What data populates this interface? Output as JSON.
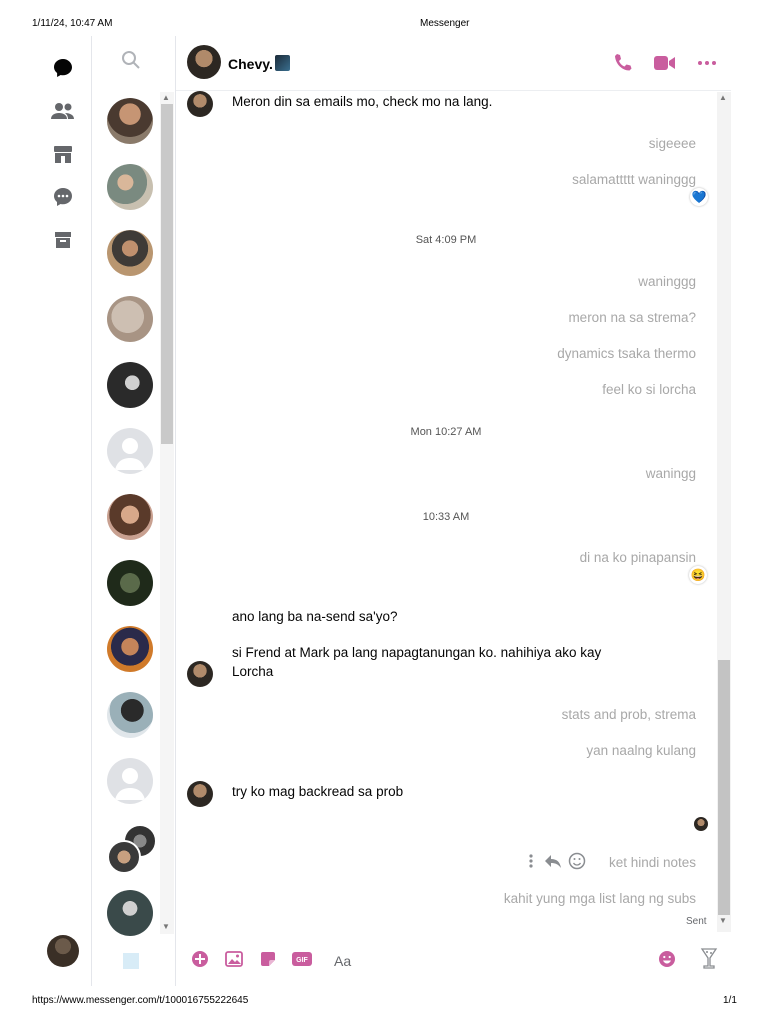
{
  "print_header": {
    "datetime": "1/11/24, 10:47 AM",
    "title": "Messenger"
  },
  "print_footer": {
    "url": "https://www.messenger.com/t/100016755222645",
    "page": "1/1"
  },
  "nav": {
    "icons": [
      "chats-icon",
      "people-icon",
      "marketplace-icon",
      "requests-icon",
      "archive-icon"
    ]
  },
  "chat_list": {
    "avatar_count": 13
  },
  "header": {
    "name": "Chevy."
  },
  "accent_color": "#c95d9e",
  "messages": [
    {
      "dir": "in",
      "text": "Meron din sa emails mo, check mo na lang."
    },
    {
      "dir": "out",
      "text": "sigeeee"
    },
    {
      "dir": "out",
      "text": "salamattttt waninggg",
      "reaction": "💙"
    },
    {
      "dir": "ts",
      "text": "Sat 4:09 PM"
    },
    {
      "dir": "out",
      "text": "waninggg"
    },
    {
      "dir": "out",
      "text": "meron na sa strema?"
    },
    {
      "dir": "out",
      "text": "dynamics tsaka thermo"
    },
    {
      "dir": "out",
      "text": "feel ko si lorcha"
    },
    {
      "dir": "ts",
      "text": "Mon 10:27 AM"
    },
    {
      "dir": "out",
      "text": "waningg"
    },
    {
      "dir": "ts",
      "text": "10:33 AM"
    },
    {
      "dir": "out",
      "text": "di na ko pinapansin",
      "reaction": "😆"
    },
    {
      "dir": "in",
      "text": "ano lang ba na-send sa'yo?"
    },
    {
      "dir": "in",
      "text": "si Frend at Mark pa lang napagtanungan ko. nahihiya ako kay"
    },
    {
      "dir": "in",
      "text": "Lorcha"
    },
    {
      "dir": "out",
      "text": "stats and prob, strema"
    },
    {
      "dir": "out",
      "text": "yan naalng kulang"
    },
    {
      "dir": "in",
      "text": "try ko mag backread sa prob"
    },
    {
      "dir": "out",
      "text": "ket hindi notes"
    },
    {
      "dir": "out",
      "text": "kahit yung mga list lang ng subs"
    }
  ],
  "status": {
    "sent": "Sent"
  },
  "composer": {
    "placeholder": "Aa"
  }
}
